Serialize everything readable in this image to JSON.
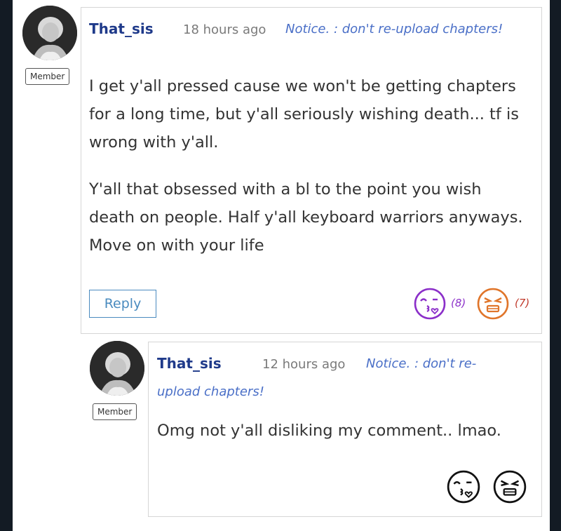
{
  "comments": [
    {
      "username": "That_sis",
      "badge": "Member",
      "time": "18 hours ago",
      "notice": "Notice. : don't re-upload chapters!",
      "paragraphs": [
        "I get y'all pressed cause we won't be getting chapters for a long time, but y'all seriously wishing death... tf is wrong with y'all.",
        "Y'all that obsessed with a bl to the point you wish death on people. Half y'all keyboard warriors anyways.  Move on with your life"
      ],
      "reply_label": "Reply",
      "like_count": "(8)",
      "dislike_count": "(7)",
      "like_color": "#8b2fc9",
      "dislike_color": "#e0752a"
    },
    {
      "username": "That_sis",
      "badge": "Member",
      "time": "12 hours ago",
      "notice_line1": "Notice. : don't re-",
      "notice_line2": "upload chapters!",
      "paragraphs": [
        "Omg not y'all disliking my comment.. lmao."
      ],
      "like_color": "#111111",
      "dislike_color": "#111111"
    }
  ]
}
